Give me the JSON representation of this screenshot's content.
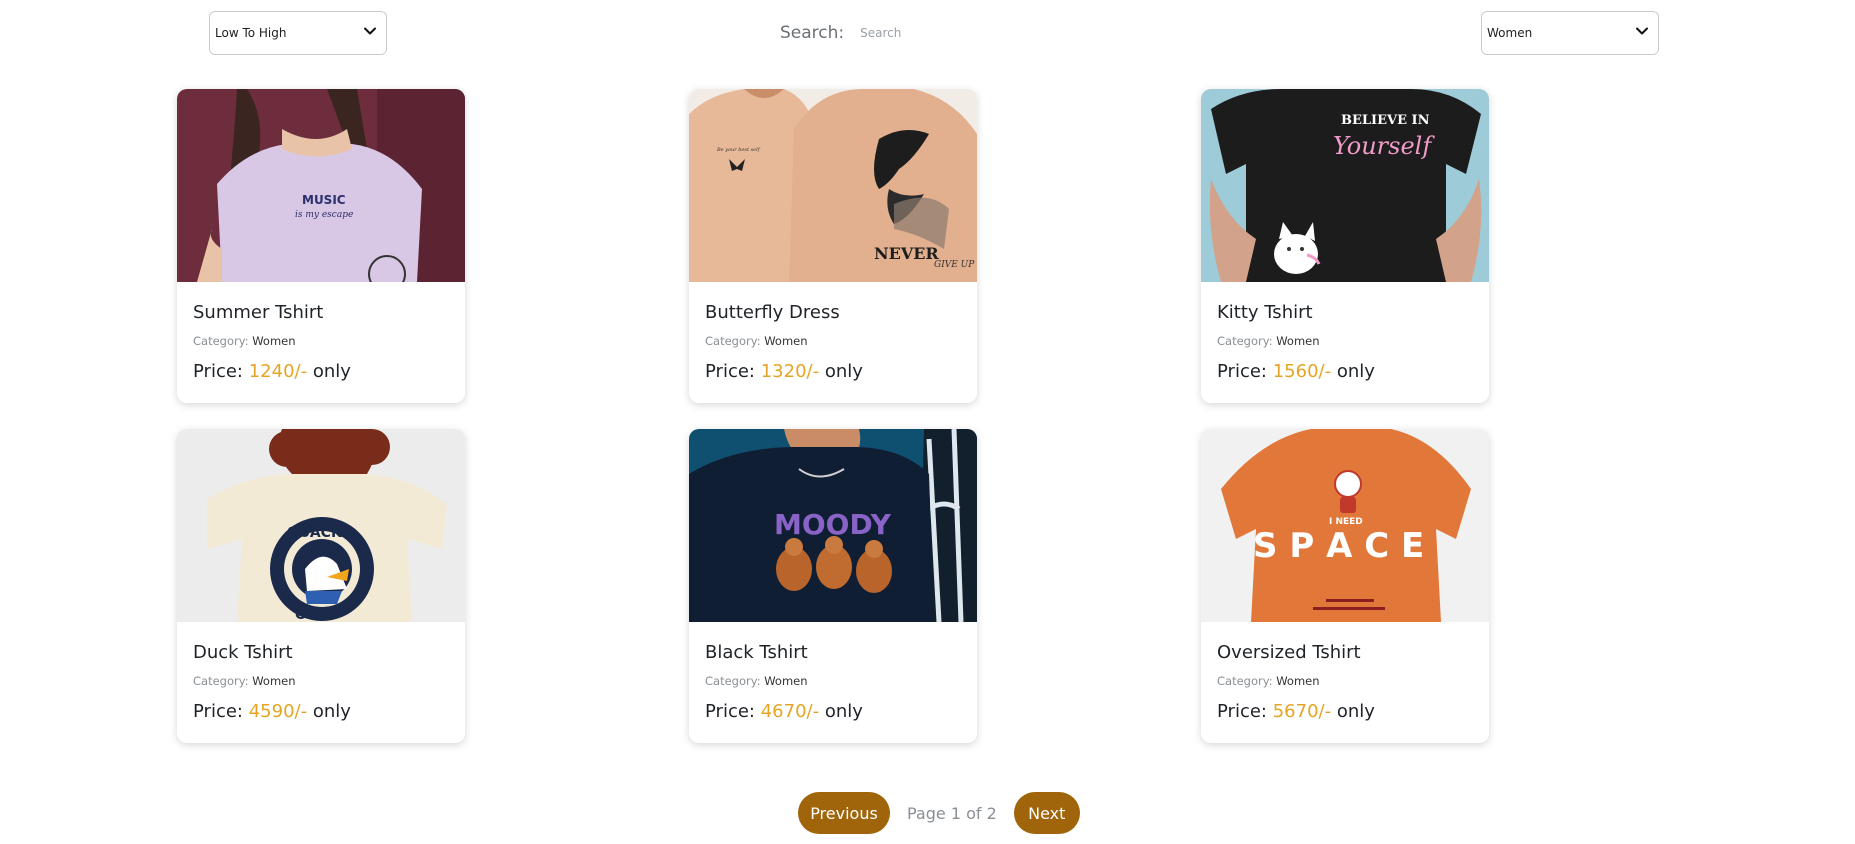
{
  "toolbar": {
    "sort_value": "Low To High",
    "search_label": "Search:",
    "search_placeholder": "Search",
    "category_value": "Women"
  },
  "products": [
    {
      "title": "Summer Tshirt",
      "category_label": "Category:",
      "category": "Women",
      "price_label": "Price:",
      "price": "1240/-",
      "price_suffix": "only",
      "image": "lavender-tshirt-music-is-my-escape"
    },
    {
      "title": "Butterfly Dress",
      "category_label": "Category:",
      "category": "Women",
      "price_label": "Price:",
      "price": "1320/-",
      "price_suffix": "only",
      "image": "beige-tshirt-butterfly-print"
    },
    {
      "title": "Kitty Tshirt",
      "category_label": "Category:",
      "category": "Women",
      "price_label": "Price:",
      "price": "1560/-",
      "price_suffix": "only",
      "image": "black-tshirt-believe-in-yourself-cat",
      "print_text": [
        "BELIEVE IN",
        "Yourself"
      ]
    },
    {
      "title": "Duck Tshirt",
      "category_label": "Category:",
      "category": "Women",
      "price_label": "Price:",
      "price": "4590/-",
      "price_suffix": "only",
      "image": "cream-tshirt-quack-off-duck",
      "print_text": [
        "QUACK",
        "OFF!"
      ]
    },
    {
      "title": "Black Tshirt",
      "category_label": "Category:",
      "category": "Women",
      "price_label": "Price:",
      "price": "4670/-",
      "price_suffix": "only",
      "image": "navy-tshirt-moody-mice",
      "print_text": [
        "MOODY"
      ]
    },
    {
      "title": "Oversized Tshirt",
      "category_label": "Category:",
      "category": "Women",
      "price_label": "Price:",
      "price": "5670/-",
      "price_suffix": "only",
      "image": "orange-tshirt-i-need-space",
      "print_text": [
        "I NEED",
        "S P A C E"
      ]
    }
  ],
  "pagination": {
    "previous_label": "Previous",
    "page_info": "Page 1 of 2",
    "next_label": "Next"
  },
  "colors": {
    "accent": "#a0650a",
    "price": "#e5a524"
  }
}
